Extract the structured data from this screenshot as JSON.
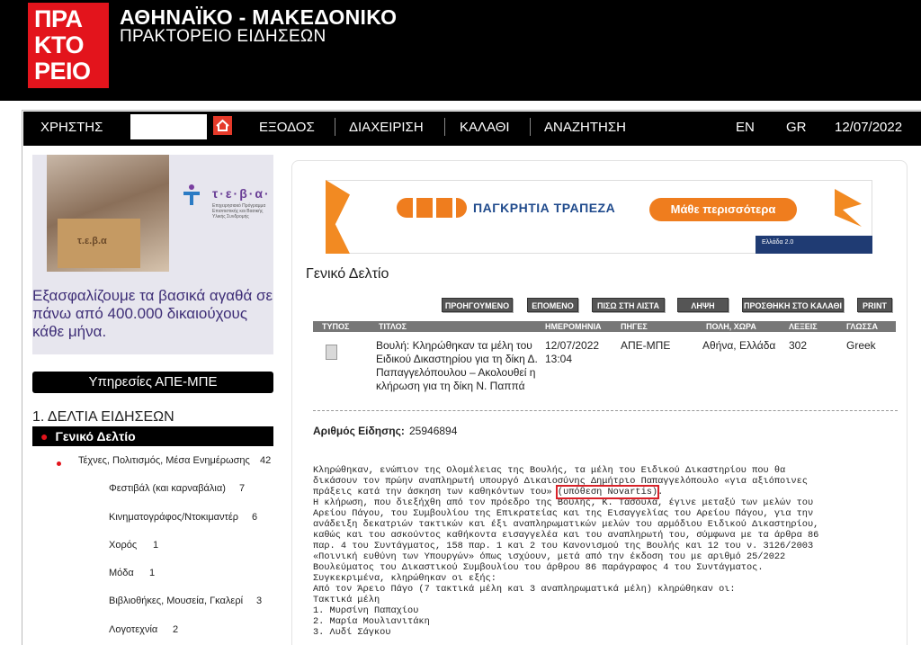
{
  "brand": {
    "logo_text": "ΠΡΑ\nΚΤΟ\nΡΕΙΟ",
    "title": "ΑΘΗΝΑΪΚΟ - ΜΑΚΕΔΟΝΙΚΟ",
    "subtitle": "ΠΡΑΚΤΟΡΕΙΟ ΕΙΔΗΣΕΩΝ"
  },
  "nav": {
    "user": "ΧΡΗΣΤΗΣ",
    "logout": "ΕΞΟΔΟΣ",
    "admin": "ΔΙΑΧΕΙΡΙΣΗ",
    "basket": "ΚΑΛΑΘΙ",
    "search": "ΑΝΑΖΗΤΗΣΗ",
    "lang_en": "EN",
    "lang_gr": "GR",
    "date": "12/07/2022"
  },
  "promo": {
    "box_label": "τ.ε.β.α",
    "teva": "τ·ε·β·α·",
    "teva_small": "Επιχειρησιακό Πρόγραμμα Επισιτιστικής και Βασικής Υλικής Συνδρομής",
    "text": "Εξασφαλίζουμε τα βασικά αγαθά σε πάνω από 400.000 δικαιούχους κάθε μήνα."
  },
  "sidebar": {
    "services": "Υπηρεσίες ΑΠΕ-ΜΠΕ",
    "section": "1. ΔΕΛΤΙΑ ΕΙΔΗΣΕΩΝ",
    "active": "Γενικό Δελτίο",
    "items": [
      {
        "label": "Τέχνες, Πολιτισμός, Μέσα Ενημέρωσης",
        "count": "42"
      },
      {
        "label": "Φεστιβάλ (και καρναβάλια)",
        "count": "7"
      },
      {
        "label": "Κινηματογράφος/Ντοκιμαντέρ",
        "count": "6"
      },
      {
        "label": "Χορός",
        "count": "1"
      },
      {
        "label": "Μόδα",
        "count": "1"
      },
      {
        "label": "Βιβλιοθήκες, Μουσεία, Γκαλερί",
        "count": "3"
      },
      {
        "label": "Λογοτεχνία",
        "count": "2"
      }
    ]
  },
  "ad": {
    "bank": "ΠΑΓΚΡΗΤΙΑ ΤΡΑΠΕΖΑ",
    "cta": "Μάθε περισσότερα",
    "footer": "Ελλάδα 2.0"
  },
  "main": {
    "title": "Γενικό Δελτίο",
    "buttons": [
      "ΠΡΟΗΓΟΥΜΕΝΟ",
      "ΕΠΟΜΕΝΟ",
      "ΠΙΣΩ ΣΤΗ ΛΙΣΤΑ",
      "ΛΗΨΗ",
      "ΠΡΟΣΘΗΚΗ ΣΤΟ ΚΑΛΑΘΙ",
      "PRINT"
    ],
    "columns": [
      "ΤΥΠΟΣ",
      "ΤΙΤΛΟΣ",
      "ΗΜΕΡΟΜΗΝΙΑ",
      "ΠΗΓΕΣ",
      "ΠΟΛΗ, ΧΩΡΑ",
      "ΛΕΞΕΙΣ",
      "ΓΛΩΣΣΑ"
    ],
    "row": {
      "title": "Βουλή: Κληρώθηκαν τα μέλη του Ειδικού Δικαστηρίου για τη δίκη Δ. Παπαγγελόπουλου – Ακολουθεί η κλήρωση για τη δίκη Ν. Παππά",
      "date": "12/07/2022\n13:04",
      "source": "ΑΠΕ-ΜΠΕ",
      "city": "Αθήνα, Ελλάδα",
      "words": "302",
      "lang": "Greek"
    },
    "id_label": "Αριθμός Είδησης:",
    "id_value": "25946894",
    "body_pre": "Κληρώθηκαν, ενώπιον της Ολομέλειας της Βουλής, τα μέλη του Ειδικού Δικαστηρίου που θα\nδικάσουν τον πρώην αναπληρωτή υπουργό Δικαιοσύνης Δημήτριο Παπαγγελόπουλο «για αξιόποινες\nπράξεις κατά την άσκηση των καθηκόντων του» ",
    "body_hl": "(υπόθεση Novartis)",
    "body_post": ".\nΗ κλήρωση, που διεξήχθη από τον πρόεδρο της Βουλής, Κ. Τασούλα, έγινε μεταξύ των μελών του\nΑρείου Πάγου, του Συμβουλίου της Επικρατείας και της Εισαγγελίας του Αρείου Πάγου, για την\nανάδειξη δεκατριών τακτικών και έξι αναπληρωματικών μελών του αρμόδιου Ειδικού Δικαστηρίου,\nκαθώς και του ασκούντος καθήκοντα εισαγγελέα και του αναπληρωτή του, σύμφωνα με τα άρθρα 86\nπαρ. 4 του Συντάγματος, 158 παρ. 1 και 2 του Κανονισμού της Βουλής και 12 του ν. 3126/2003\n«Ποινική ευθύνη των Υπουργών» όπως ισχύουν, μετά από την έκδοση του με αριθμό 25/2022\nΒουλεύματος του Δικαστικού Συμβουλίου του άρθρου 86 παράγραφος 4 του Συντάγματος.\nΣυγκεκριμένα, κληρώθηκαν οι εξής:\nΑπό τον Άρειο Πάγο (7 τακτικά μέλη και 3 αναπληρωματικά μέλη) κληρώθηκαν οι:\nΤακτικά μέλη\n1. Μυρσίνη Παπαχίου\n2. Μαρία Μουλιανιτάκη\n3. Λυδί Σάγκου"
  }
}
